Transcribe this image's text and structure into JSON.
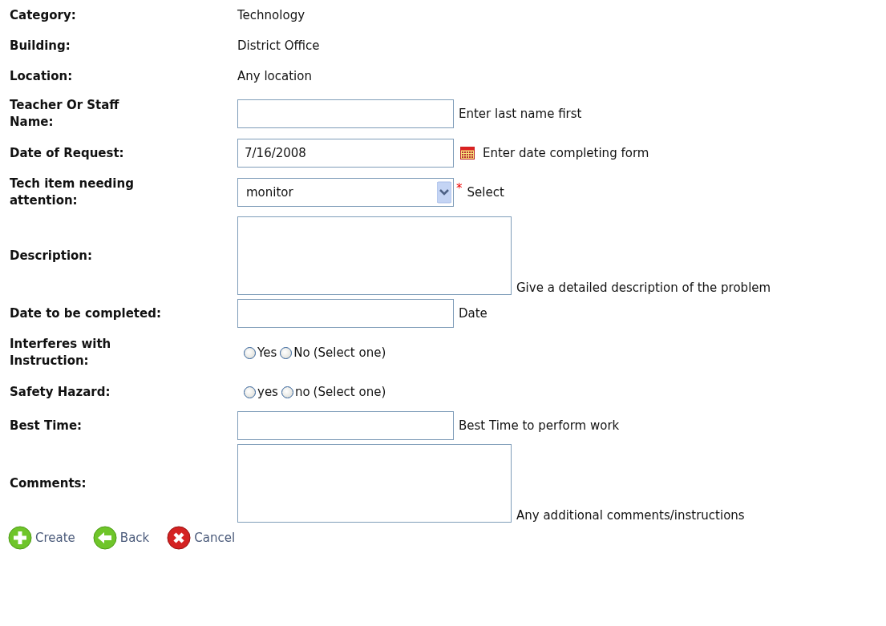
{
  "fields": [
    {
      "kind": "static",
      "label": "Category:",
      "value": "Technology"
    },
    {
      "kind": "static",
      "label": "Building:",
      "value": "District Office"
    },
    {
      "kind": "static",
      "label": "Location:",
      "value": "Any location"
    },
    {
      "kind": "text",
      "label": "Teacher Or Staff Name:",
      "hint": "Enter last name first"
    },
    {
      "kind": "date",
      "label": "Date of Request:",
      "value": "7/16/2008",
      "hint": "Enter date completing form"
    },
    {
      "kind": "select",
      "label": "Tech item needing attention:",
      "value": "monitor",
      "marker": "*",
      "hint": "Select"
    },
    {
      "kind": "textarea",
      "label": "Description:",
      "hint": "Give a detailed description of the problem"
    },
    {
      "kind": "text",
      "label": "Date to be completed:",
      "hint": "Date"
    },
    {
      "kind": "radio",
      "label": "Interferes with Instruction:",
      "options": [
        {
          "label": "Yes",
          "selected": false
        },
        {
          "label": "No",
          "selected": false
        }
      ],
      "hint": "(Select one)"
    },
    {
      "kind": "radio",
      "label": "Safety Hazard:",
      "options": [
        {
          "label": "yes",
          "selected": false
        },
        {
          "label": "no",
          "selected": false
        }
      ],
      "hint": "(Select one)"
    },
    {
      "kind": "text",
      "label": "Best Time:",
      "hint": "Best Time to perform work"
    },
    {
      "kind": "textarea",
      "label": "Comments:",
      "hint": "Any additional comments/instructions"
    }
  ],
  "actions": [
    {
      "kind": "create",
      "label": "Create"
    },
    {
      "kind": "back",
      "label": "Back"
    },
    {
      "kind": "cancel",
      "label": "Cancel"
    }
  ]
}
